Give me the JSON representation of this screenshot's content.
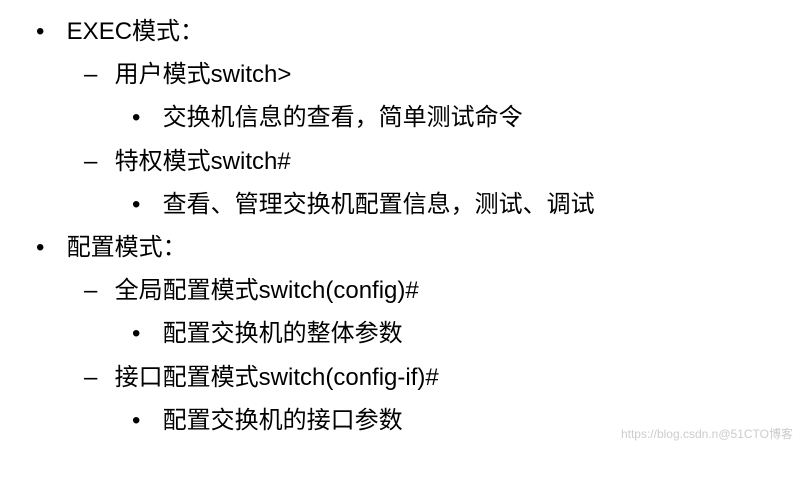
{
  "items": [
    {
      "text": "EXEC模式：",
      "children": [
        {
          "text": "用户模式switch>",
          "children": [
            {
              "text": "交换机信息的查看，简单测试命令"
            }
          ]
        },
        {
          "text": "特权模式switch#",
          "children": [
            {
              "text": "查看、管理交换机配置信息，测试、调试"
            }
          ]
        }
      ]
    },
    {
      "text": "配置模式：",
      "children": [
        {
          "text": "全局配置模式switch(config)#",
          "children": [
            {
              "text": "配置交换机的整体参数"
            }
          ]
        },
        {
          "text": "接口配置模式switch(config-if)#",
          "children": [
            {
              "text": "配置交换机的接口参数"
            }
          ]
        }
      ]
    }
  ],
  "watermark": "https://blog.csdn.n@51CTO博客"
}
